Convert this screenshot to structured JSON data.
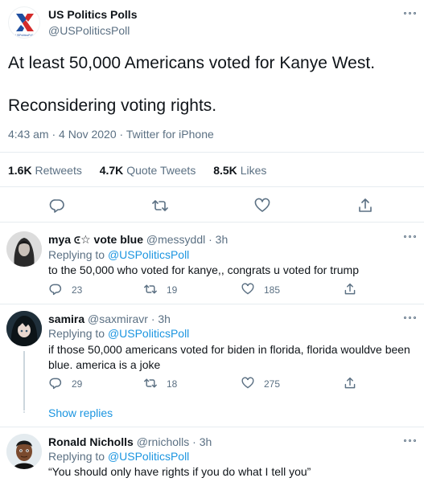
{
  "main_tweet": {
    "display_name": "US Politics Polls",
    "handle": "@USPoliticsPoll",
    "text_line1": "At least 50,000 Americans voted for Kanye West.",
    "text_line2": "Reconsidering voting rights.",
    "meta": "4:43 am · 4 Nov 2020 · Twitter for iPhone",
    "retweets_count": "1.6K",
    "retweets_label": "Retweets",
    "quote_count": "4.7K",
    "quote_label": "Quote Tweets",
    "likes_count": "8.5K",
    "likes_label": "Likes",
    "actions": [
      "reply-icon",
      "retweet-icon",
      "like-icon",
      "share-icon"
    ],
    "avatar_logo": "us-politics-polls-logo",
    "avatar_logo_text": "USPoliticsPolls"
  },
  "replies": [
    {
      "display_name": "mya ⪽☆ vote blue",
      "handle": "@messyddl",
      "time": "· 3h",
      "replying_label": "Replying to",
      "replying_handle": "@USPoliticsPoll",
      "text": "to the 50,000 who voted for kanye,, congrats u voted for trump",
      "reply_count": "23",
      "retweet_count": "19",
      "like_count": "185"
    },
    {
      "display_name": "samira",
      "handle": "@saxmiravr",
      "time": "· 3h",
      "replying_label": "Replying to",
      "replying_handle": "@USPoliticsPoll",
      "text": "if those 50,000 americans voted for biden in florida, florida wouldve been blue. america is a joke",
      "reply_count": "29",
      "retweet_count": "18",
      "like_count": "275"
    },
    {
      "display_name": "Ronald Nicholls",
      "handle": "@rnicholls",
      "time": "· 3h",
      "replying_label": "Replying to",
      "replying_handle": "@USPoliticsPoll",
      "text": "“You should only have rights if you do what I tell you”"
    }
  ],
  "show_replies": "Show replies",
  "colors": {
    "accent": "#1b95e0",
    "text": "#0f1419",
    "secondary": "#5b7083",
    "border": "#e6ecf0"
  }
}
